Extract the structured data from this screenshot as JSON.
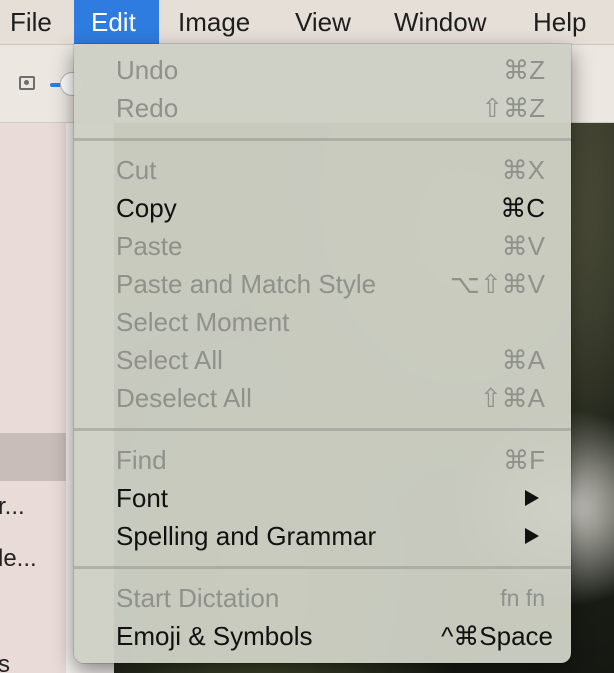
{
  "menubar": {
    "items": [
      {
        "label": "File"
      },
      {
        "label": "Edit"
      },
      {
        "label": "Image"
      },
      {
        "label": "View"
      },
      {
        "label": "Window"
      },
      {
        "label": "Help"
      }
    ],
    "active_item": "Edit",
    "active_color": "#2e7ce0"
  },
  "sidebar": {
    "visible_fragments": [
      "r...",
      "le...",
      "s"
    ]
  },
  "edit_menu": {
    "groups": [
      [
        {
          "label": "Undo",
          "shortcut": "⌘Z",
          "enabled": false
        },
        {
          "label": "Redo",
          "shortcut": "⇧⌘Z",
          "enabled": false
        }
      ],
      [
        {
          "label": "Cut",
          "shortcut": "⌘X",
          "enabled": false
        },
        {
          "label": "Copy",
          "shortcut": "⌘C",
          "enabled": true
        },
        {
          "label": "Paste",
          "shortcut": "⌘V",
          "enabled": false
        },
        {
          "label": "Paste and Match Style",
          "shortcut": "⌥⇧⌘V",
          "enabled": false
        },
        {
          "label": "Select Moment",
          "shortcut": "",
          "enabled": false
        },
        {
          "label": "Select All",
          "shortcut": "⌘A",
          "enabled": false
        },
        {
          "label": "Deselect All",
          "shortcut": "⇧⌘A",
          "enabled": false
        }
      ],
      [
        {
          "label": "Find",
          "shortcut": "⌘F",
          "enabled": false
        },
        {
          "label": "Font",
          "shortcut": "",
          "enabled": true,
          "submenu": true
        },
        {
          "label": "Spelling and Grammar",
          "shortcut": "",
          "enabled": true,
          "submenu": true
        }
      ],
      [
        {
          "label": "Start Dictation",
          "shortcut": "fn fn",
          "enabled": false
        },
        {
          "label": "Emoji & Symbols",
          "shortcut": "^⌘Space",
          "enabled": true
        }
      ]
    ]
  }
}
